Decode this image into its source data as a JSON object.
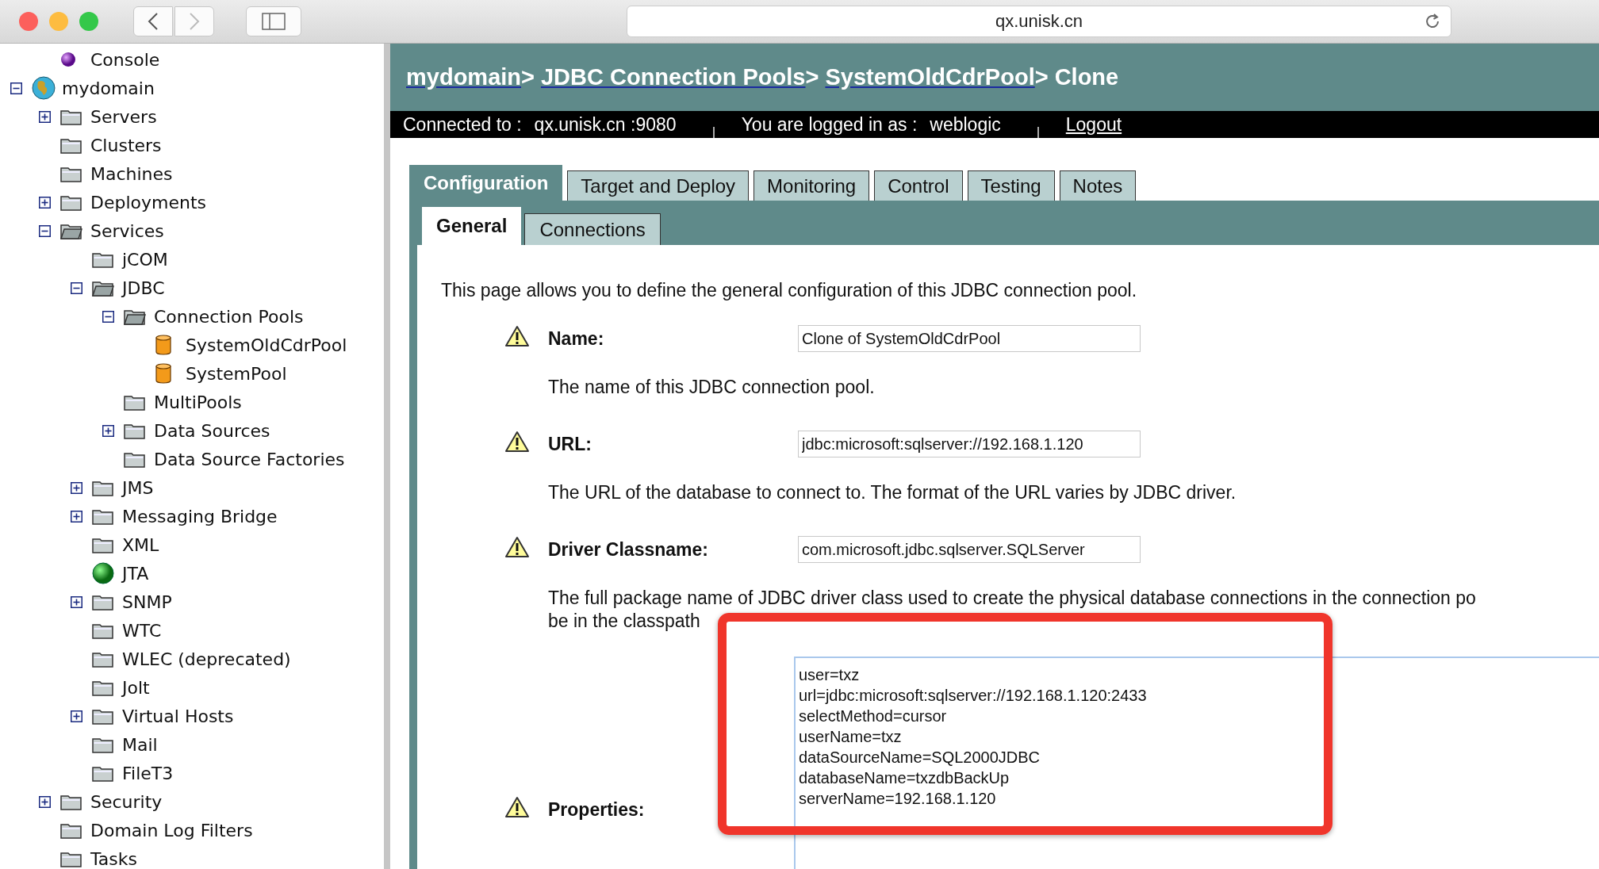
{
  "browser": {
    "address": "qx.unisk.cn"
  },
  "tree": [
    {
      "label": "Console",
      "kind": "console"
    },
    {
      "label": "mydomain",
      "kind": "domain",
      "expanded": true,
      "children": [
        {
          "label": "Servers",
          "kind": "folder",
          "expanded": false
        },
        {
          "label": "Clusters",
          "kind": "folder"
        },
        {
          "label": "Machines",
          "kind": "folder"
        },
        {
          "label": "Deployments",
          "kind": "folder",
          "expanded": false
        },
        {
          "label": "Services",
          "kind": "folder",
          "expanded": true,
          "children": [
            {
              "label": "jCOM",
              "kind": "folder"
            },
            {
              "label": "JDBC",
              "kind": "folder",
              "expanded": true,
              "children": [
                {
                  "label": "Connection Pools",
                  "kind": "folder",
                  "expanded": true,
                  "children": [
                    {
                      "label": "SystemOldCdrPool",
                      "kind": "pool"
                    },
                    {
                      "label": "SystemPool",
                      "kind": "pool"
                    }
                  ]
                },
                {
                  "label": "MultiPools",
                  "kind": "folder"
                },
                {
                  "label": "Data Sources",
                  "kind": "folder",
                  "expanded": false
                },
                {
                  "label": "Data Source Factories",
                  "kind": "folder"
                }
              ]
            },
            {
              "label": "JMS",
              "kind": "folder",
              "expanded": false
            },
            {
              "label": "Messaging Bridge",
              "kind": "folder",
              "expanded": false
            },
            {
              "label": "XML",
              "kind": "folder"
            },
            {
              "label": "JTA",
              "kind": "status"
            },
            {
              "label": "SNMP",
              "kind": "folder",
              "expanded": false
            },
            {
              "label": "WTC",
              "kind": "folder"
            },
            {
              "label": "WLEC (deprecated)",
              "kind": "folder"
            },
            {
              "label": "Jolt",
              "kind": "folder"
            },
            {
              "label": "Virtual Hosts",
              "kind": "folder",
              "expanded": false
            },
            {
              "label": "Mail",
              "kind": "folder"
            },
            {
              "label": "FileT3",
              "kind": "folder"
            }
          ]
        },
        {
          "label": "Security",
          "kind": "folder",
          "expanded": false
        },
        {
          "label": "Domain Log Filters",
          "kind": "folder"
        },
        {
          "label": "Tasks",
          "kind": "folder"
        }
      ]
    }
  ],
  "breadcrumb": [
    {
      "label": "mydomain",
      "link": true,
      "separator": ">"
    },
    {
      "label": "JDBC Connection Pools",
      "link": true,
      "separator": ">"
    },
    {
      "label": "SystemOldCdrPool",
      "link": true,
      "separator": ">"
    },
    {
      "label": "Clone",
      "link": false
    }
  ],
  "status_bar": {
    "connected_label": "Connected to :",
    "host": "qx.unisk.cn :9080",
    "user_label": "You are logged in as :",
    "user": "weblogic",
    "logout": "Logout"
  },
  "tabs": [
    {
      "label": "Configuration",
      "selected": true
    },
    {
      "label": "Target and Deploy",
      "selected": false
    },
    {
      "label": "Monitoring",
      "selected": false
    },
    {
      "label": "Control",
      "selected": false
    },
    {
      "label": "Testing",
      "selected": false
    },
    {
      "label": "Notes",
      "selected": false
    }
  ],
  "subtabs": [
    {
      "label": "General",
      "selected": true
    },
    {
      "label": "Connections",
      "selected": false
    }
  ],
  "intro": "This page allows you to define the general configuration of this JDBC connection pool.",
  "fields": [
    {
      "kind": "text",
      "label": "Name:",
      "value": "Clone of SystemOldCdrPool",
      "description": [
        "The name of this JDBC connection pool."
      ]
    },
    {
      "kind": "text",
      "label": "URL:",
      "value": "jdbc:microsoft:sqlserver://192.168.1.120",
      "description": [
        "The URL of the database to connect to. The format of the URL varies by JDBC driver."
      ]
    },
    {
      "kind": "text",
      "label": "Driver Classname:",
      "value": "com.microsoft.jdbc.sqlserver.SQLServer",
      "description": [
        "The full package name of JDBC driver class used to create the physical database connections in the connection po",
        "be in the classpath"
      ]
    },
    {
      "kind": "textarea",
      "label": "Properties:",
      "value": "user=txz\nurl=jdbc:microsoft:sqlserver://192.168.1.120:2433\nselectMethod=cursor\nuserName=txz\ndataSourceName=SQL2000JDBC\ndatabaseName=txzdbBackUp\nserverName=192.168.1.120"
    }
  ],
  "annotations": [
    {
      "kind": "highlight"
    }
  ]
}
